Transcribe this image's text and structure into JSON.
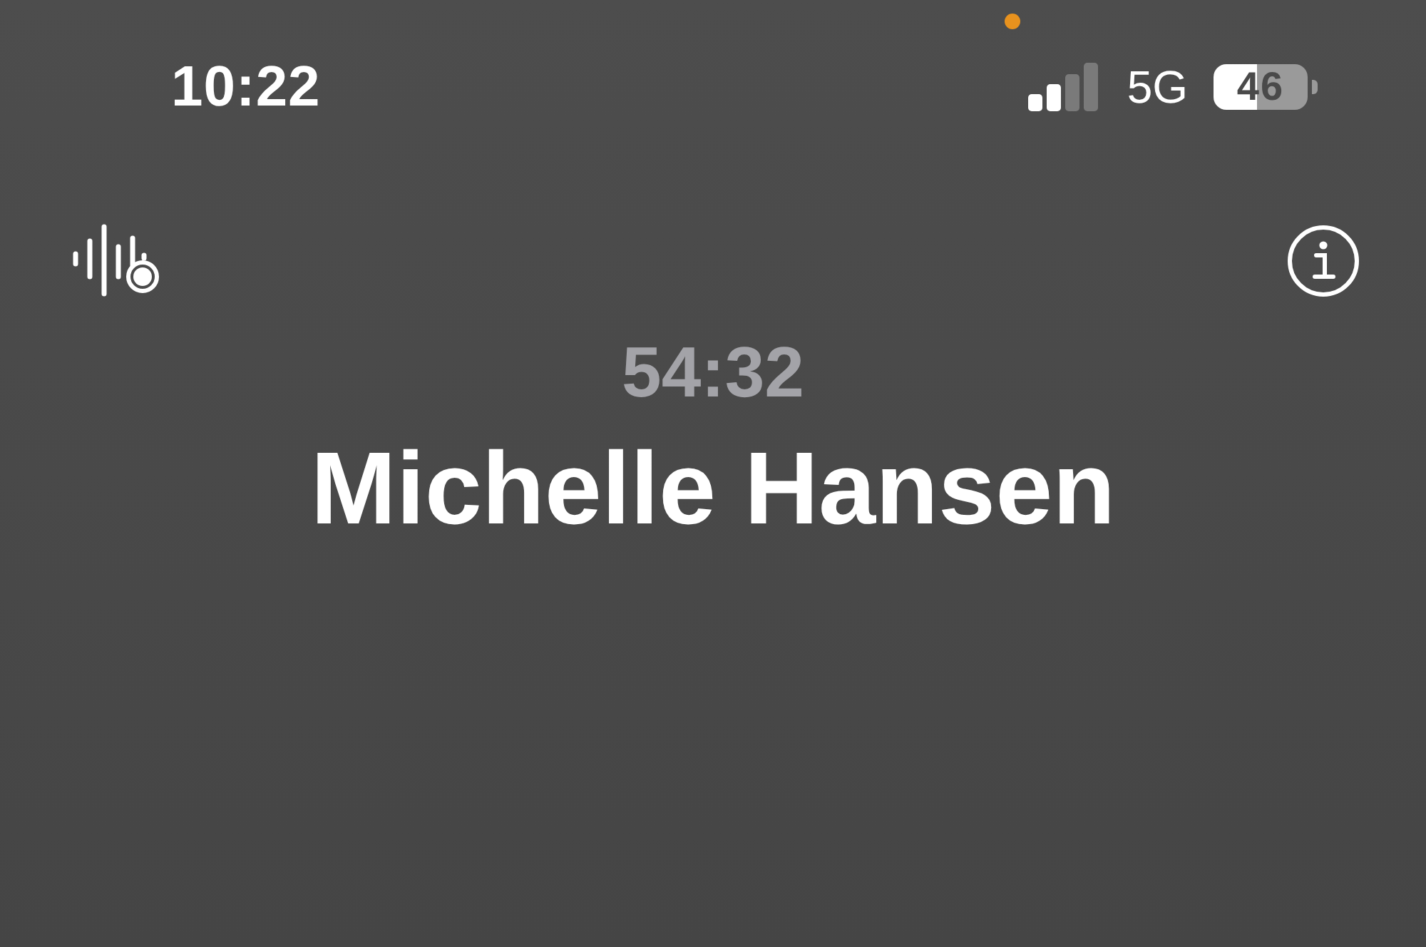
{
  "status_bar": {
    "time": "10:22",
    "network": "5G",
    "battery": "46"
  },
  "call": {
    "duration": "54:32",
    "contact_name": "Michelle Hansen"
  }
}
